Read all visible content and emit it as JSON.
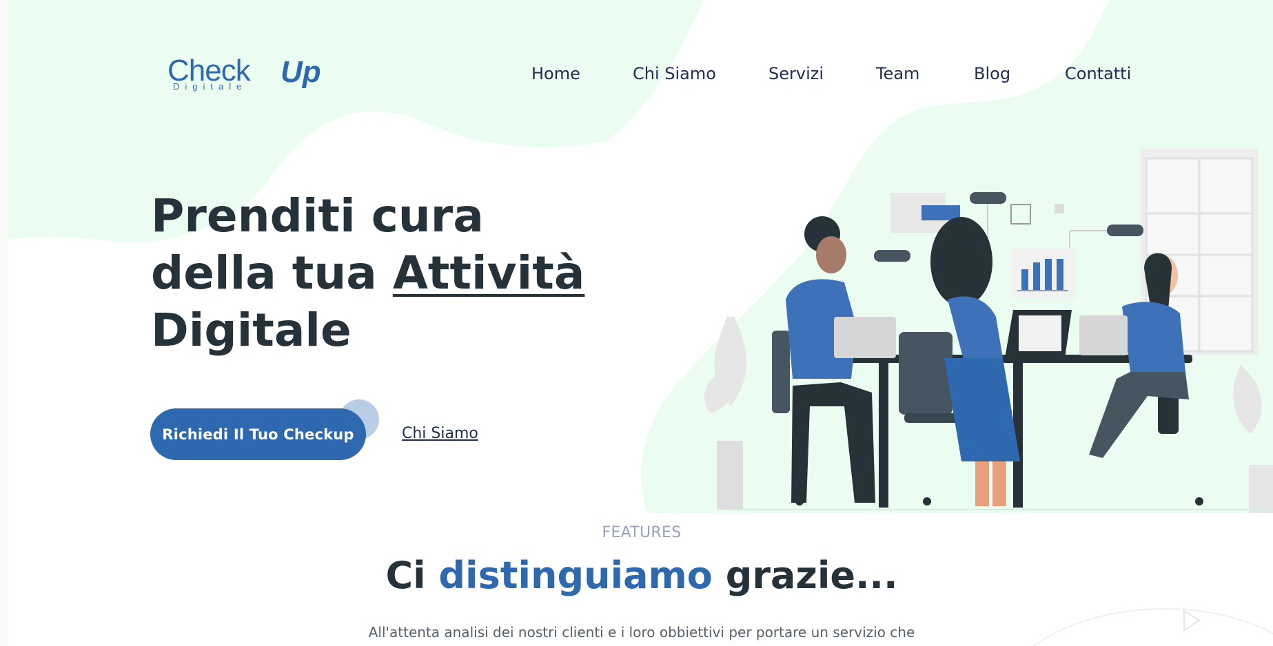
{
  "brand": {
    "logo_main": "Check",
    "logo_accent": "Up",
    "logo_sub": "Digitale"
  },
  "nav": {
    "items": [
      {
        "label": "Home"
      },
      {
        "label": "Chi Siamo"
      },
      {
        "label": "Servizi"
      },
      {
        "label": "Team"
      },
      {
        "label": "Blog"
      },
      {
        "label": "Contatti"
      }
    ]
  },
  "hero": {
    "line1": "Prenditi cura",
    "line2_prefix": "della tua ",
    "line2_emphasis": "Attività",
    "line3": "Digitale",
    "cta_label": "Richiedi Il Tuo Checkup",
    "secondary_link": "Chi Siamo"
  },
  "features": {
    "eyebrow": "FEATURES",
    "title_prefix": "Ci ",
    "title_accent": "distinguiamo",
    "title_suffix": " grazie...",
    "description": "All'attenta analisi dei nostri clienti e i loro obbiettivi per portare un servizio che"
  },
  "colors": {
    "primary": "#2e69b0",
    "heading": "#26323a",
    "nav_text": "#1f2d4f",
    "blob": "#ebfdf0",
    "muted": "#9aa2ba"
  },
  "icons": [
    "play-icon",
    "chart-icon"
  ]
}
